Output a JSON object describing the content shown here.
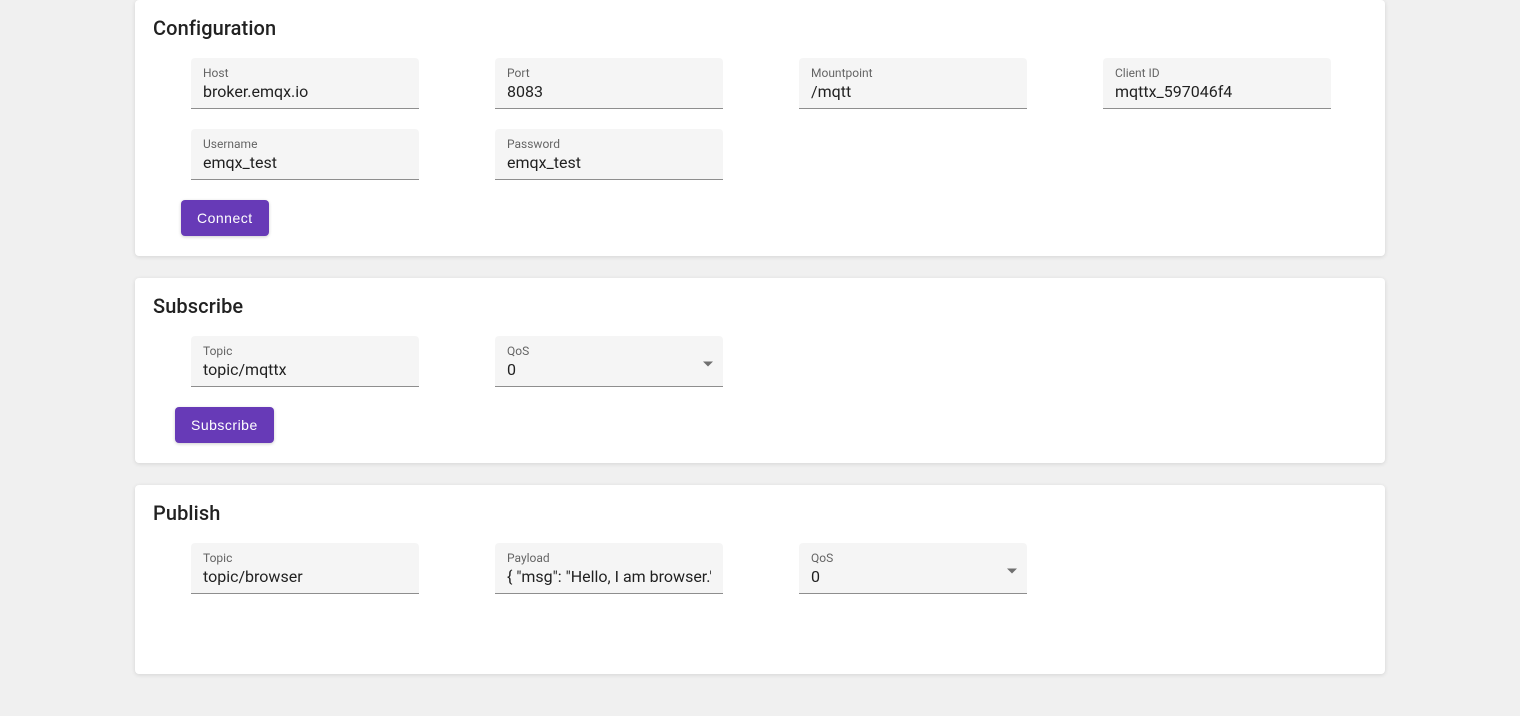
{
  "configuration": {
    "title": "Configuration",
    "host": {
      "label": "Host",
      "value": "broker.emqx.io"
    },
    "port": {
      "label": "Port",
      "value": "8083"
    },
    "mountpoint": {
      "label": "Mountpoint",
      "value": "/mqtt"
    },
    "clientId": {
      "label": "Client ID",
      "value": "mqttx_597046f4"
    },
    "username": {
      "label": "Username",
      "value": "emqx_test"
    },
    "password": {
      "label": "Password",
      "value": "emqx_test"
    },
    "connectLabel": "Connect"
  },
  "subscribe": {
    "title": "Subscribe",
    "topic": {
      "label": "Topic",
      "value": "topic/mqttx"
    },
    "qos": {
      "label": "QoS",
      "value": "0"
    },
    "subscribeLabel": "Subscribe"
  },
  "publish": {
    "title": "Publish",
    "topic": {
      "label": "Topic",
      "value": "topic/browser"
    },
    "payload": {
      "label": "Payload",
      "value": "{ \"msg\": \"Hello, I am browser.\""
    },
    "qos": {
      "label": "QoS",
      "value": "0"
    }
  }
}
